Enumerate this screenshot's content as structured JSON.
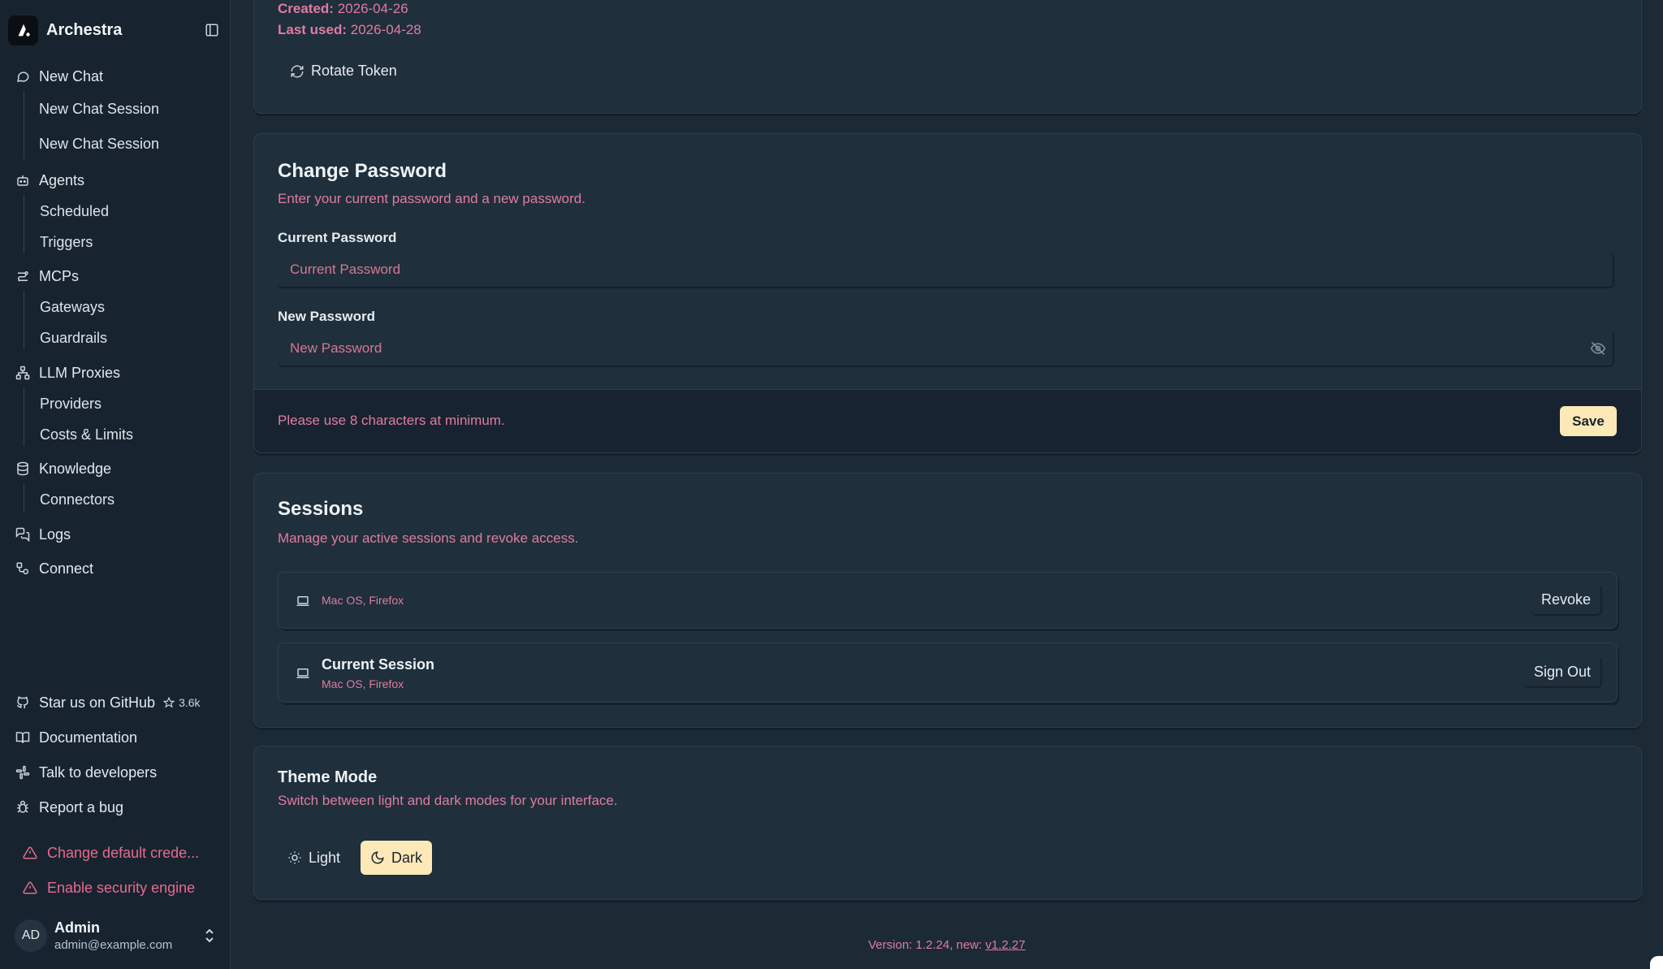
{
  "app": {
    "name": "Archestra"
  },
  "sidebar": {
    "new_chat": "New Chat",
    "chat_sessions": [
      "New Chat Session",
      "New Chat Session"
    ],
    "agents": "Agents",
    "agents_sub": [
      "Scheduled",
      "Triggers"
    ],
    "mcps": "MCPs",
    "mcps_sub": [
      "Gateways",
      "Guardrails"
    ],
    "llm_proxies": "LLM Proxies",
    "llm_sub": [
      "Providers",
      "Costs & Limits"
    ],
    "knowledge": "Knowledge",
    "knowledge_sub": [
      "Connectors"
    ],
    "logs": "Logs",
    "connect": "Connect",
    "github": "Star us on GitHub",
    "github_stars": "3.6k",
    "documentation": "Documentation",
    "talk": "Talk to developers",
    "bug": "Report a bug",
    "warnings": [
      "Change default crede...",
      "Enable security engine"
    ],
    "user": {
      "initials": "AD",
      "name": "Admin",
      "email": "admin@example.com"
    }
  },
  "token": {
    "created_label": "Created:",
    "created_value": "2026-04-26",
    "last_used_label": "Last used:",
    "last_used_value": "2026-04-28",
    "rotate_label": "Rotate Token"
  },
  "password": {
    "title": "Change Password",
    "description": "Enter your current password and a new password.",
    "current_label": "Current Password",
    "current_placeholder": "Current Password",
    "new_label": "New Password",
    "new_placeholder": "New Password",
    "hint": "Please use 8 characters at minimum.",
    "save_label": "Save"
  },
  "sessions": {
    "title": "Sessions",
    "description": "Manage your active sessions and revoke access.",
    "items": [
      {
        "title": "",
        "device": "Mac OS, Firefox",
        "action": "Revoke"
      },
      {
        "title": "Current Session",
        "device": "Mac OS, Firefox",
        "action": "Sign Out"
      }
    ]
  },
  "theme": {
    "title": "Theme Mode",
    "description": "Switch between light and dark modes for your interface.",
    "light_label": "Light",
    "dark_label": "Dark",
    "selected": "Dark"
  },
  "footer": {
    "version_text": "Version: 1.2.24, new: ",
    "new_version": "v1.2.27"
  },
  "colors": {
    "accent": "#fde9b8",
    "muted_text": "#e07ca0",
    "background": "#1c2a36",
    "sidebar": "#172430"
  }
}
